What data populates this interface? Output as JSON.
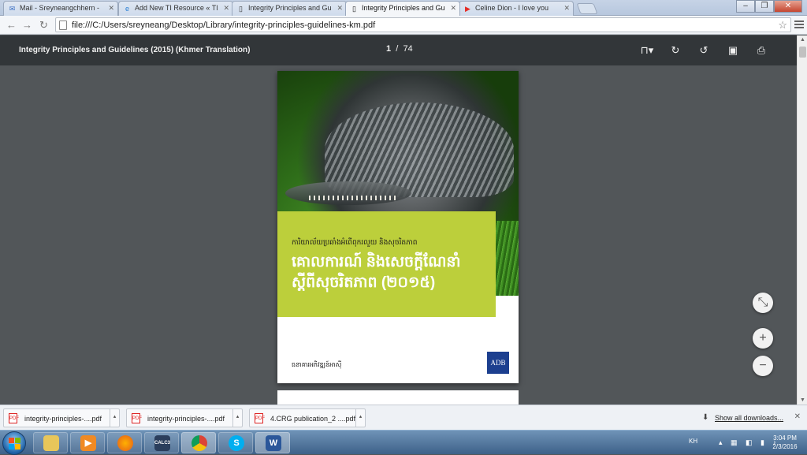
{
  "browser": {
    "tabs": [
      {
        "title": "Mail - Sreyneangchhern - ",
        "icon": "mail-icon",
        "active": false
      },
      {
        "title": "Add New TI Resource « TI",
        "icon": "ie-icon",
        "active": false
      },
      {
        "title": "Integrity Principles and Gu",
        "icon": "document-icon",
        "active": false
      },
      {
        "title": "Integrity Principles and Gu",
        "icon": "document-icon",
        "active": true
      },
      {
        "title": "Celine Dion - I love you",
        "icon": "youtube-icon",
        "active": false
      }
    ],
    "url": "file:///C:/Users/sreyneang/Desktop/Library/integrity-principles-guidelines-km.pdf"
  },
  "pdf_viewer": {
    "title": "Integrity Principles and Guidelines (2015) (Khmer Translation)",
    "current_page": "1",
    "separator": "/",
    "total_pages": "74"
  },
  "document": {
    "subtitle": "ការិយាល័យប្រឆាំងអំពើពុករលួយ និងសុចរិតភាព",
    "title": "គោលការណ៍ និងសេចក្តីណែនាំ ស្តីពីសុចរិតភាព (២០១៥)",
    "publisher": "ធនាគារអភិវឌ្ឍន៍អាស៊ី",
    "logo_text": "ADB"
  },
  "downloads": {
    "items": [
      {
        "name": "integrity-principles-....pdf"
      },
      {
        "name": "integrity-principles-....pdf"
      },
      {
        "name": "4.CRG publication_2 ....pdf"
      }
    ],
    "show_all": "Show all downloads..."
  },
  "taskbar": {
    "language": "KH",
    "time": "3:04 PM",
    "date": "2/3/2016",
    "word_label": "W",
    "calc_label": "CALC3"
  },
  "colors": {
    "accent_green": "#bccf3b",
    "pdf_toolbar": "#323639",
    "viewer_bg": "#525659",
    "adb_blue": "#1c3f8f"
  }
}
